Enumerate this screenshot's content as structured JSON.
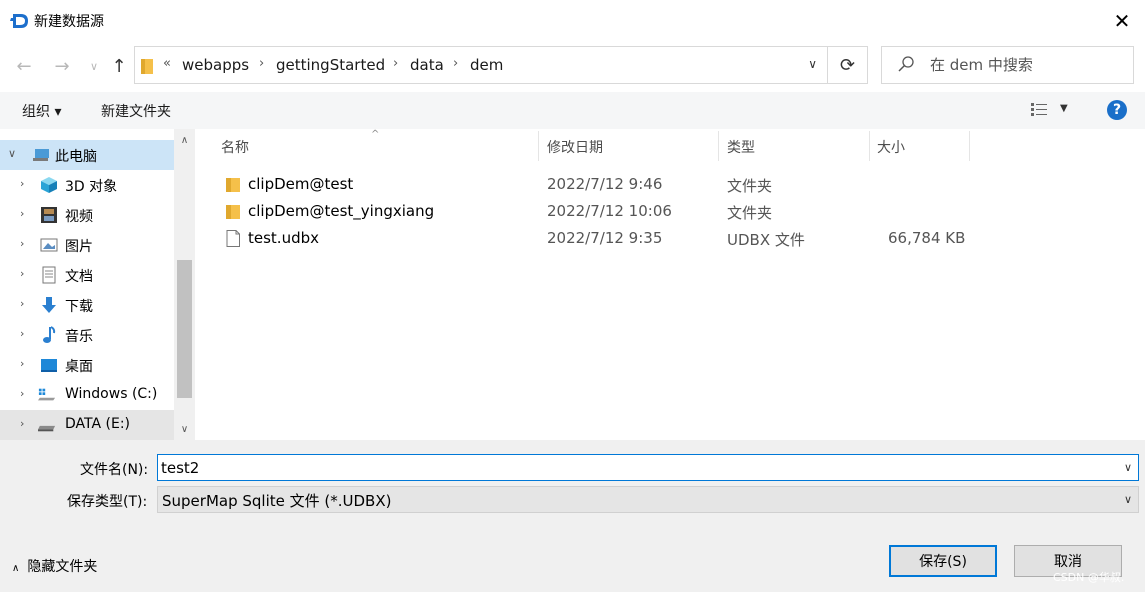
{
  "window": {
    "title": "新建数据源",
    "close": "✕"
  },
  "nav": {
    "back": "←",
    "forward": "→",
    "recent": "∨",
    "up": "↑",
    "sep": "«",
    "crumbs": [
      "webapps",
      "gettingStarted",
      "data",
      "dem"
    ],
    "crumb_sep": "›",
    "refresh": "⟳",
    "search_placeholder": "在 dem 中搜索"
  },
  "toolbar": {
    "organize": "组织 ▾",
    "new_folder": "新建文件夹",
    "help": "?"
  },
  "tree": [
    {
      "label": "此电脑",
      "icon": "computer-icon",
      "expanded": true
    },
    {
      "label": "3D 对象",
      "icon": "cube-icon"
    },
    {
      "label": "视频",
      "icon": "film-icon"
    },
    {
      "label": "图片",
      "icon": "picture-icon"
    },
    {
      "label": "文档",
      "icon": "document-icon"
    },
    {
      "label": "下载",
      "icon": "download-icon"
    },
    {
      "label": "音乐",
      "icon": "music-icon"
    },
    {
      "label": "桌面",
      "icon": "desktop-icon"
    },
    {
      "label": "Windows (C:)",
      "icon": "drive-c-icon"
    },
    {
      "label": "DATA (E:)",
      "icon": "drive-e-icon"
    }
  ],
  "tree_arrows": {
    "expanded": "∨",
    "collapsed": "›"
  },
  "scroll": {
    "up": "∧",
    "down": "∨"
  },
  "columns": {
    "name": "名称",
    "date": "修改日期",
    "type": "类型",
    "size": "大小",
    "sort": "^"
  },
  "files": [
    {
      "name": "clipDem@test",
      "date": "2022/7/12 9:46",
      "type": "文件夹",
      "size": "",
      "icon": "folder-icon"
    },
    {
      "name": "clipDem@test_yingxiang",
      "date": "2022/7/12 10:06",
      "type": "文件夹",
      "size": "",
      "icon": "folder-icon"
    },
    {
      "name": "test.udbx",
      "date": "2022/7/12 9:35",
      "type": "UDBX 文件",
      "size": "66,784 KB",
      "icon": "file-icon"
    }
  ],
  "form": {
    "filename_label": "文件名(N):",
    "filename_value": "test2",
    "filetype_label": "保存类型(T):",
    "filetype_value": "SuperMap Sqlite 文件 (*.UDBX)",
    "dropdown": "∨",
    "hide_folders": "隐藏文件夹",
    "hide_arrow": "∧",
    "save": "保存(S)",
    "cancel": "取消",
    "watermark": "CSDN @华叔."
  },
  "colors": {
    "accent": "#0078d7",
    "selected": "#cce4f7",
    "folder": "#f5c04a",
    "help": "#1a6fc9"
  }
}
